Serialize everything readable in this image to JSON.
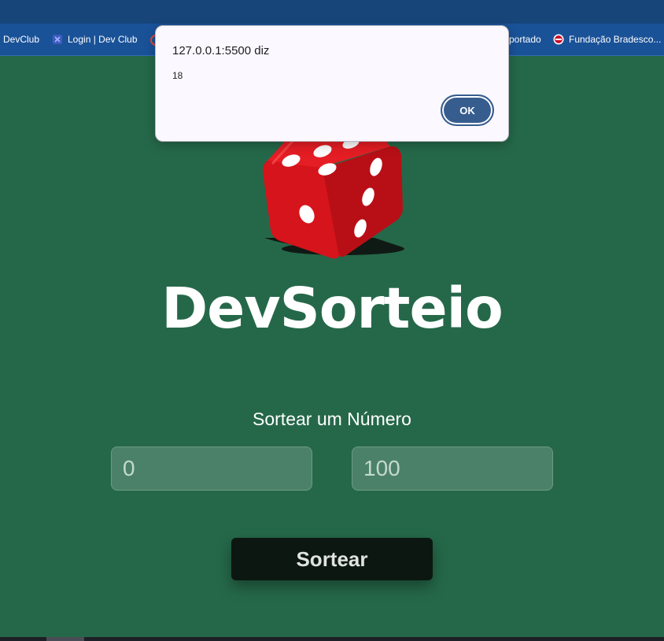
{
  "bookmarks": [
    {
      "label": "DevClub",
      "icon": "devclub-icon"
    },
    {
      "label": "Login | Dev Club",
      "icon": "devclub-login-icon"
    },
    {
      "label": "portado",
      "icon": ""
    },
    {
      "label": "Fundação Bradesco...",
      "icon": "fundacao-bradesco-icon"
    }
  ],
  "app": {
    "title": "DevSorteio",
    "subtitle": "Sortear um Número",
    "inputs": {
      "min_value": "0",
      "max_value": "100"
    },
    "draw_button_label": "Sortear",
    "logo_icon": "dice-icon"
  },
  "alert": {
    "title": "127.0.0.1:5500 diz",
    "message": "18",
    "ok_label": "OK"
  },
  "colors": {
    "page_background": "#256849",
    "browser_topbar": "#17457a",
    "bookmarks_bar": "#1a5298",
    "button_background": "#0d1712",
    "input_background": "#4b8169",
    "dialog_background": "#fcf8ff",
    "ok_button": "#375d8f",
    "dice_red": "#e0141c"
  }
}
